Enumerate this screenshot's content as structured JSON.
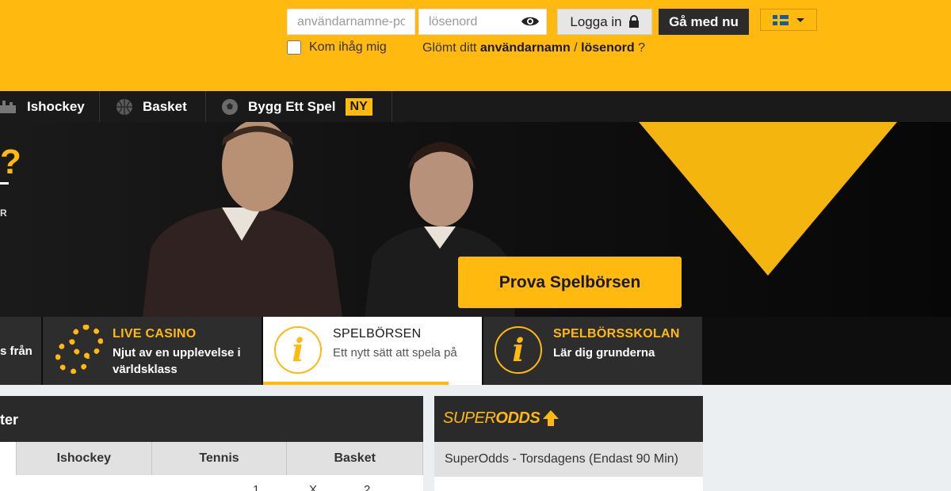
{
  "header": {
    "username_placeholder": "användarnamne-post",
    "password_placeholder": "lösenord",
    "login_label": "Logga in",
    "join_label": "Gå med nu",
    "language": "sv",
    "remember_label": "Kom ihåg mig",
    "forgot_prefix": "Glömt ditt ",
    "forgot_username": "användarnamn",
    "forgot_sep": " / ",
    "forgot_password": "lösenord",
    "forgot_suffix": " ?"
  },
  "nav": {
    "items": [
      {
        "label": "Ishockey",
        "icon": "ice-hockey-icon"
      },
      {
        "label": "Basket",
        "icon": "basketball-icon"
      },
      {
        "label": "Bygg Ett Spel",
        "icon": "soccer-ball-icon",
        "badge": "NY"
      }
    ]
  },
  "hero": {
    "partial_heading": "?",
    "partial_text": "R",
    "cta_label": "Prova Spelbörsen"
  },
  "tiles": [
    {
      "title": "",
      "subtitle": "s från"
    },
    {
      "title": "LIVE CASINO",
      "subtitle": "Njut av en upplevelse i världsklass",
      "icon": "casino-chip-icon"
    },
    {
      "title": "SPELBÖRSEN",
      "subtitle": "Ett nytt sätt att spela på",
      "icon": "info-icon",
      "active": true
    },
    {
      "title": "SPELBÖRSSKOLAN",
      "subtitle": "Lär dig grunderna",
      "icon": "info-icon"
    }
  ],
  "left_panel": {
    "title_partial": "ter",
    "tabs": [
      "Ishockey",
      "Tennis",
      "Basket"
    ],
    "odds_headers": [
      "1",
      "X",
      "2"
    ]
  },
  "right_panel": {
    "logo_super": "SUPER",
    "logo_odds": "ODDS",
    "row_label": "SuperOdds - Torsdagens (Endast 90 Min)"
  },
  "colors": {
    "brand_yellow": "#ffb90f",
    "dark": "#1a1a1a"
  }
}
